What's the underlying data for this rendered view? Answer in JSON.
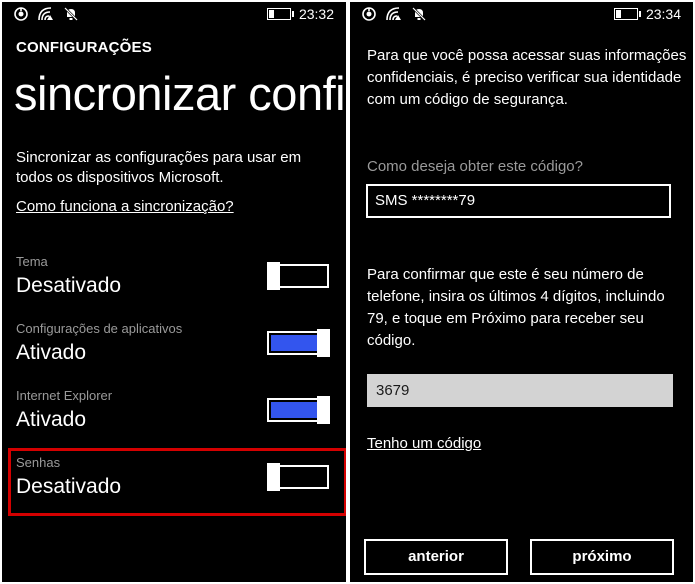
{
  "left_screen": {
    "status": {
      "time": "23:32"
    },
    "app_title": "CONFIGURAÇÕES",
    "page_title": "sincronizar configurações",
    "description": "Sincronizar as configurações para usar em todos os dispositivos Microsoft.",
    "help_link": "Como funciona a sincronização?",
    "settings": [
      {
        "label": "Tema",
        "value": "Desativado",
        "on": false
      },
      {
        "label": "Configurações de aplicativos",
        "value": "Ativado",
        "on": true
      },
      {
        "label": "Internet Explorer",
        "value": "Ativado",
        "on": true
      },
      {
        "label": "Senhas",
        "value": "Desativado",
        "on": false
      }
    ],
    "highlight_color": "#d40000",
    "toggle_on_color": "#3355ee"
  },
  "right_screen": {
    "status": {
      "time": "23:34"
    },
    "intro": "Para que você possa acessar suas informações confidenciais, é preciso verificar sua identidade com um código de segurança.",
    "method_label": "Como deseja obter este código?",
    "method_value": "SMS ********79",
    "confirm_text": "Para confirmar que este é seu número de telefone, insira os últimos 4 dígitos, incluindo 79, e toque em Próximo para receber seu código.",
    "digits_value": "3679",
    "have_code_link": "Tenho um código",
    "back_button": "anterior",
    "next_button": "próximo"
  },
  "icons": [
    "signal-icon",
    "wifi-icon",
    "bell-off-icon",
    "battery-icon"
  ]
}
